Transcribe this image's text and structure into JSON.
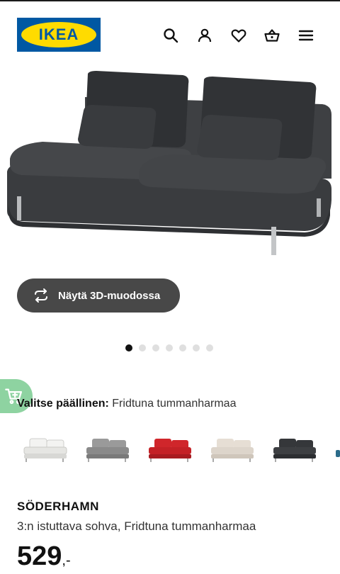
{
  "brand": {
    "logo_text": "IKEA",
    "logo_blue": "#0058a3",
    "logo_yellow": "#ffdb00"
  },
  "header": {
    "icons": [
      "search-icon",
      "user-icon",
      "heart-icon",
      "basket-icon",
      "menu-icon"
    ]
  },
  "hero": {
    "image": "sofa-image",
    "view_3d_label": "Näytä 3D-muodossa",
    "carousel_total": 7,
    "carousel_active": 1
  },
  "cover": {
    "label": "Valitse päällinen:",
    "value": "Fridtuna tummanharmaa"
  },
  "variants": [
    {
      "name": "white",
      "color": "#ececea"
    },
    {
      "name": "grey",
      "color": "#8f8f8f"
    },
    {
      "name": "red",
      "color": "#c42126"
    },
    {
      "name": "beige",
      "color": "#ddd5cb"
    },
    {
      "name": "dark-grey",
      "color": "#3d3f42"
    }
  ],
  "product": {
    "name": "SÖDERHAMN",
    "description": "3:n istuttava sohva, Fridtuna tummanharmaa",
    "price": "529",
    "price_suffix": ",-"
  },
  "accent": {
    "cart_fab": "#8ed3a1",
    "button_dark": "#484848"
  }
}
